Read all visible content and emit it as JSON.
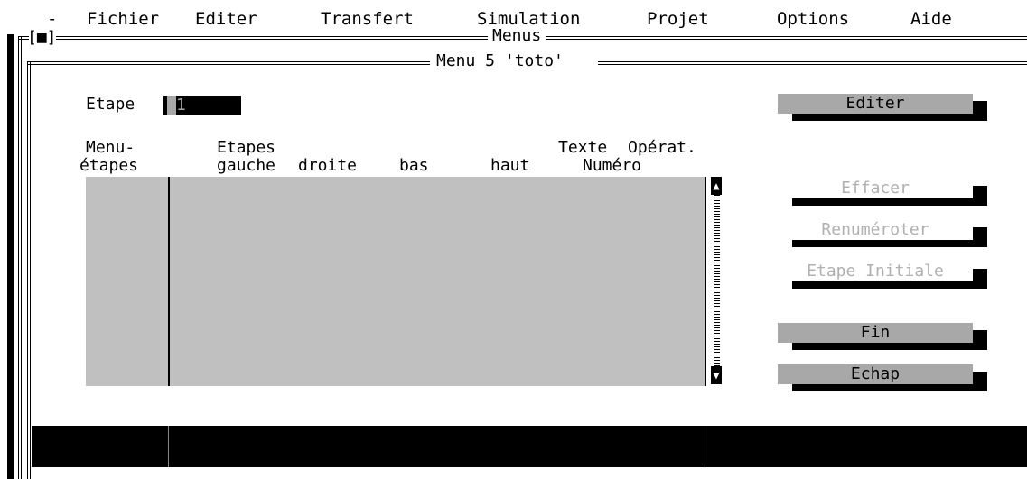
{
  "menubar": {
    "system": "-",
    "items": [
      "Fichier",
      "Editer",
      "Transfert",
      "Simulation",
      "Projet",
      "Options",
      "Aide"
    ]
  },
  "window": {
    "control": "[■]",
    "title": "Menus",
    "subtitle": "Menu 5 'toto'"
  },
  "form": {
    "etape_label": "Etape",
    "etape_value": "1"
  },
  "table": {
    "headers": {
      "menu_etapes_1": "Menu-",
      "menu_etapes_2": "étapes",
      "etapes": "Etapes",
      "gauche": "gauche",
      "droite": "droite",
      "bas": "bas",
      "haut": "haut",
      "texte": "Texte",
      "numero": "Numéro",
      "operat": "Opérat."
    },
    "rows": []
  },
  "buttons": {
    "editer": "Editer",
    "effacer": "Effacer",
    "renumeroter": "Renuméroter",
    "etape_initiale": "Etape Initiale",
    "fin": "Fin",
    "echap": "Echap"
  },
  "colors": {
    "background": "#ffffff",
    "list_background": "#c0c0c0",
    "button_face": "#a8a8a8",
    "disabled_text": "#b0b0b0",
    "statusbar": "#000000"
  }
}
